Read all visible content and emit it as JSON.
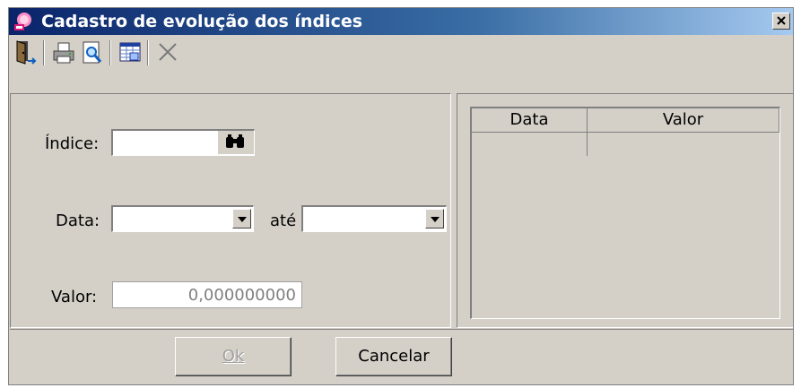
{
  "window": {
    "title": "Cadastro de evolução dos índices",
    "close_label": "×"
  },
  "toolbar": {
    "items": [
      "exit-icon",
      "printer-icon",
      "print-preview-icon",
      "grid-window-icon",
      "delete-icon"
    ]
  },
  "form": {
    "indice_label": "Índice:",
    "indice_value": "",
    "data_label": "Data:",
    "data_from_value": "",
    "ate_label": "até",
    "data_to_value": "",
    "valor_label": "Valor:",
    "valor_value": "0,000000000"
  },
  "table": {
    "columns": [
      "Data",
      "Valor"
    ],
    "rows": []
  },
  "buttons": {
    "ok_label": "Ok",
    "cancelar_label": "Cancelar"
  },
  "colors": {
    "title_gradient_start": "#0a246a",
    "title_gradient_end": "#a6caf0",
    "face": "#d4d0c8"
  }
}
